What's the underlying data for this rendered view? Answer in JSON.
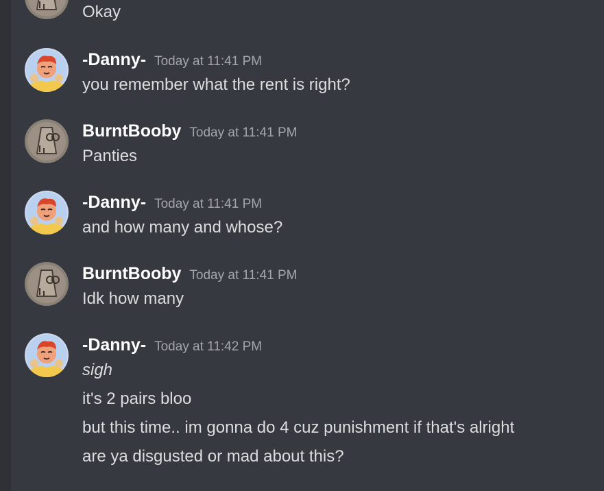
{
  "colors": {
    "background": "#36393f",
    "rail": "#2f3136",
    "username": "#ffffff",
    "text": "#dcddde",
    "timestamp": "#a3a6aa"
  },
  "avatars": {
    "danny": "cartoon-character-icon",
    "burnt": "sketch-doodle-icon"
  },
  "messages": [
    {
      "content": [
        "Okay"
      ]
    },
    {
      "username": "-Danny-",
      "timestamp": "Today at 11:41 PM",
      "content": [
        "you remember what the rent is right?"
      ]
    },
    {
      "username": "BurntBooby",
      "timestamp": "Today at 11:41 PM",
      "content": [
        "Panties"
      ]
    },
    {
      "username": "-Danny-",
      "timestamp": "Today at 11:41 PM",
      "content": [
        "and how many and whose?"
      ]
    },
    {
      "username": "BurntBooby",
      "timestamp": "Today at 11:41 PM",
      "content": [
        "Idk how many"
      ]
    },
    {
      "username": "-Danny-",
      "timestamp": "Today at 11:42 PM",
      "content": [
        "sigh",
        "it's 2 pairs bloo",
        "but this time.. im gonna do 4 cuz punishment if that's alright",
        "are ya disgusted or mad about this?"
      ]
    }
  ]
}
